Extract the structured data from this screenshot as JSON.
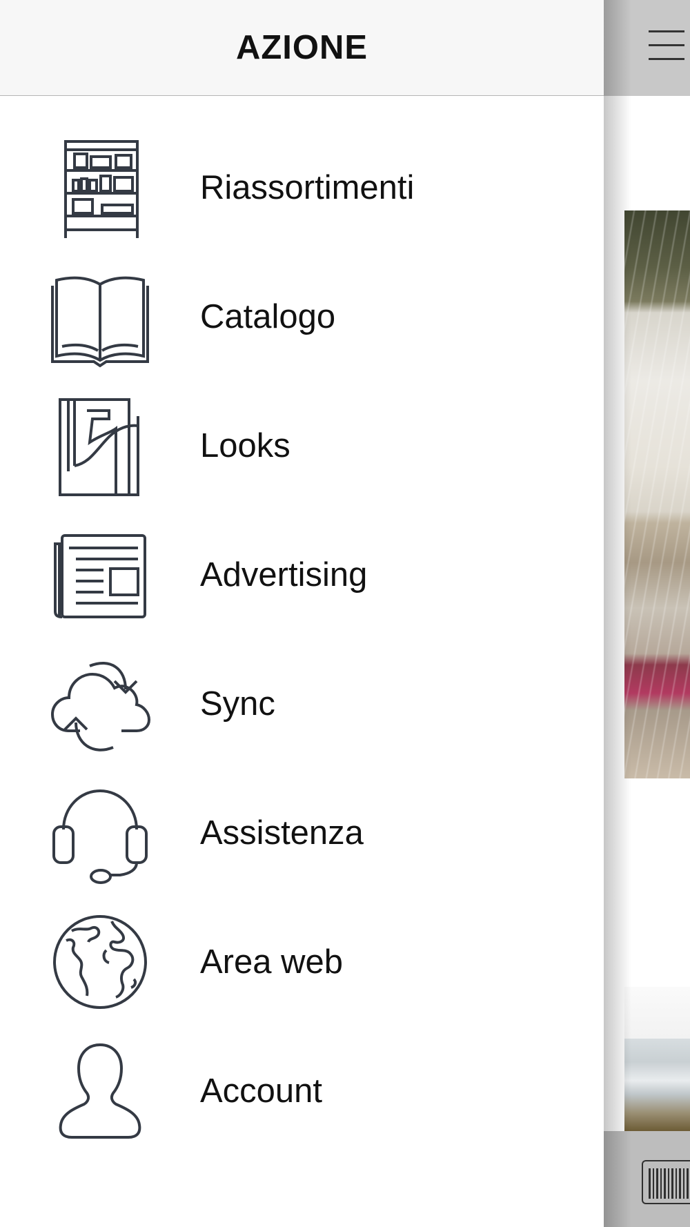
{
  "drawer": {
    "title": "AZIONE",
    "items": [
      {
        "label": "Riassortimenti",
        "icon": "shelves-icon"
      },
      {
        "label": "Catalogo",
        "icon": "open-book-icon"
      },
      {
        "label": "Looks",
        "icon": "fashion-sketch-icon"
      },
      {
        "label": "Advertising",
        "icon": "newspaper-icon"
      },
      {
        "label": "Sync",
        "icon": "cloud-sync-icon"
      },
      {
        "label": "Assistenza",
        "icon": "headset-icon"
      },
      {
        "label": "Area web",
        "icon": "globe-icon"
      },
      {
        "label": "Account",
        "icon": "user-icon"
      }
    ]
  },
  "main": {
    "menu_icon": "hamburger-menu-icon",
    "bottom_icon": "barcode-icon"
  },
  "colors": {
    "icon_stroke": "#343a44",
    "header_bg": "#f7f7f7",
    "topbar_bg": "#c8c8c8",
    "bottombar_bg": "#bdbdbd"
  }
}
